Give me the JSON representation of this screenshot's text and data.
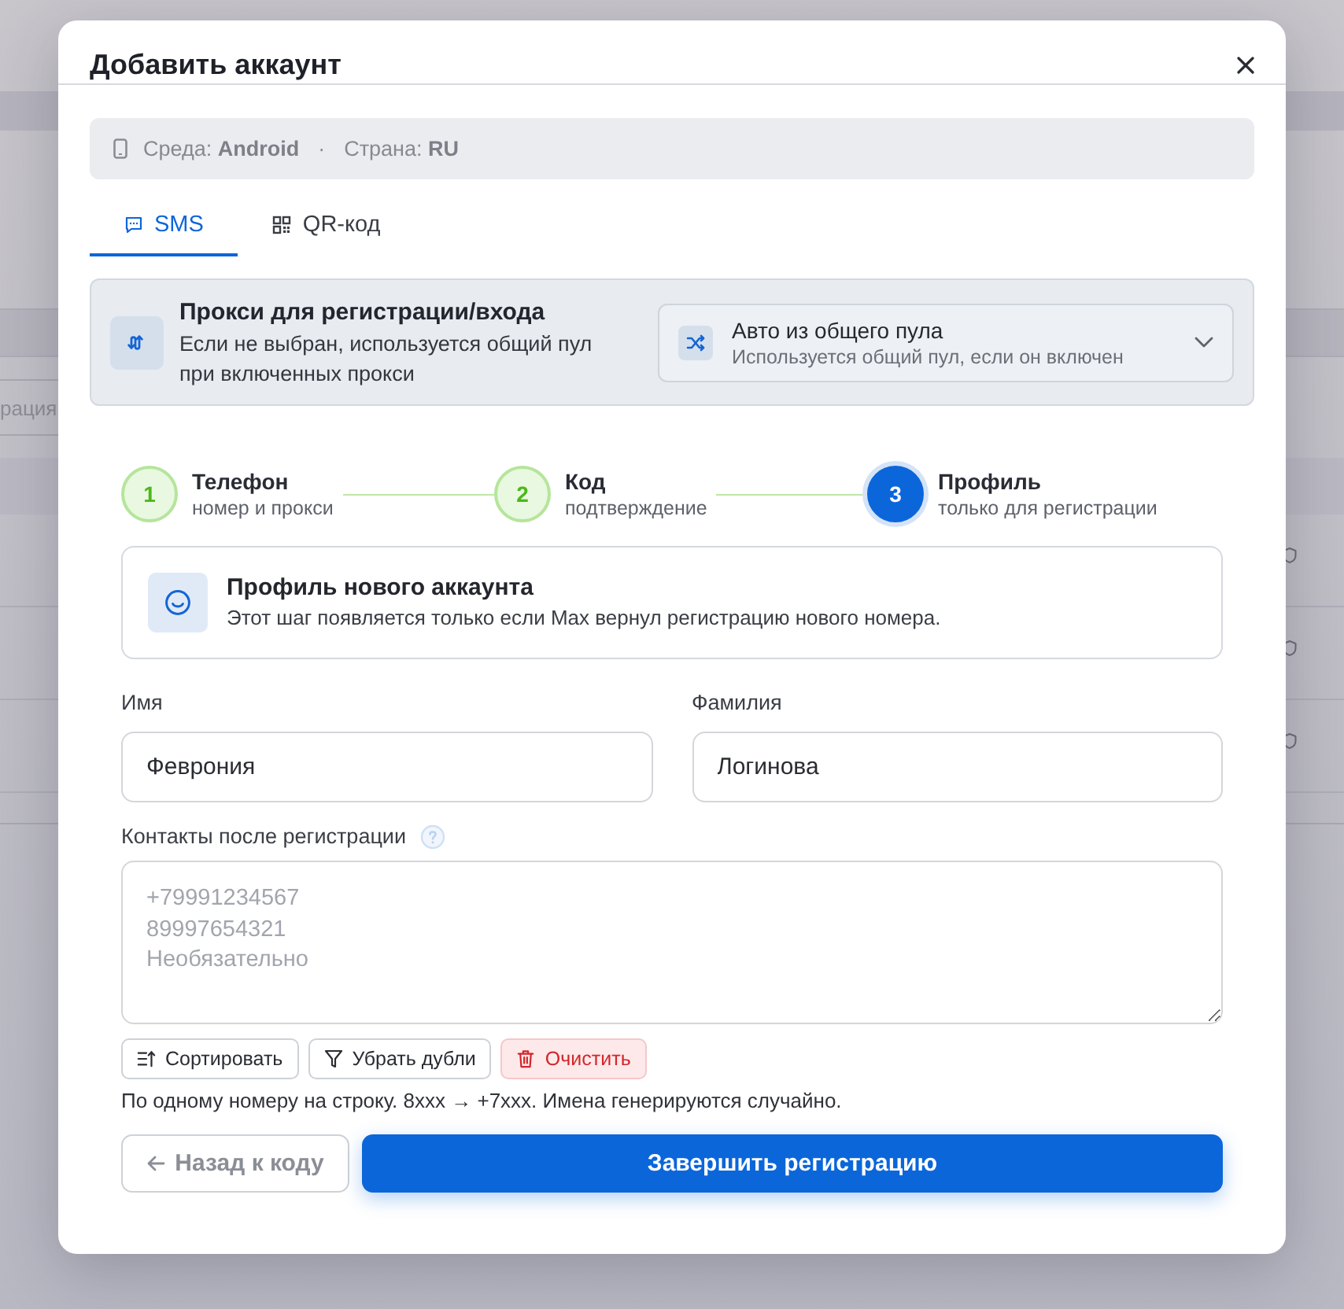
{
  "background": {
    "field_text": "рация"
  },
  "dialog": {
    "title": "Добавить аккаунт"
  },
  "environment": {
    "items": [
      "Среда: **Android**",
      "Страна: **RU**"
    ],
    "separator": "·"
  },
  "tabs": [
    {
      "label": "SMS",
      "kind": "sms",
      "selected": true
    },
    {
      "label": "QR-код",
      "kind": "qr",
      "selected": false
    }
  ],
  "proxy": {
    "title": "Прокси для регистрации/входа",
    "description": "Если не выбран, используется общий пул при включенных прокси",
    "select": {
      "value": "Авто из общего пула",
      "hint": "Используется общий пул, если он включен"
    }
  },
  "stepper": [
    {
      "number": "1",
      "title": "Телефон",
      "subtitle": "номер и прокси",
      "selected": false
    },
    {
      "number": "2",
      "title": "Код",
      "subtitle": "подтверждение",
      "selected": false
    },
    {
      "number": "3",
      "title": "Профиль",
      "subtitle": "только для регистрации",
      "selected": true
    }
  ],
  "profile_card": {
    "title": "Профиль нового аккаунта",
    "description": "Этот шаг появляется только если Max вернул регистрацию нового номера."
  },
  "fields": [
    {
      "label": "Имя",
      "value": "Феврония"
    },
    {
      "label": "Фамилия",
      "value": "Логинова"
    }
  ],
  "contacts": {
    "label": "Контакты после регистрации",
    "placeholder": "+79991234567\n89997654321\nНеобязательно",
    "tools": [
      {
        "label": "Сортировать",
        "kind": "sort"
      },
      {
        "label": "Убрать дубли",
        "kind": "dedupe"
      },
      {
        "label": "Очистить",
        "kind": "clear"
      }
    ],
    "hint": "По одному номеру на строку. 8xxx → +7xxx. Имена генерируются случайно."
  },
  "footer": {
    "back": "Назад к коду",
    "submit": "Завершить регистрацию"
  }
}
